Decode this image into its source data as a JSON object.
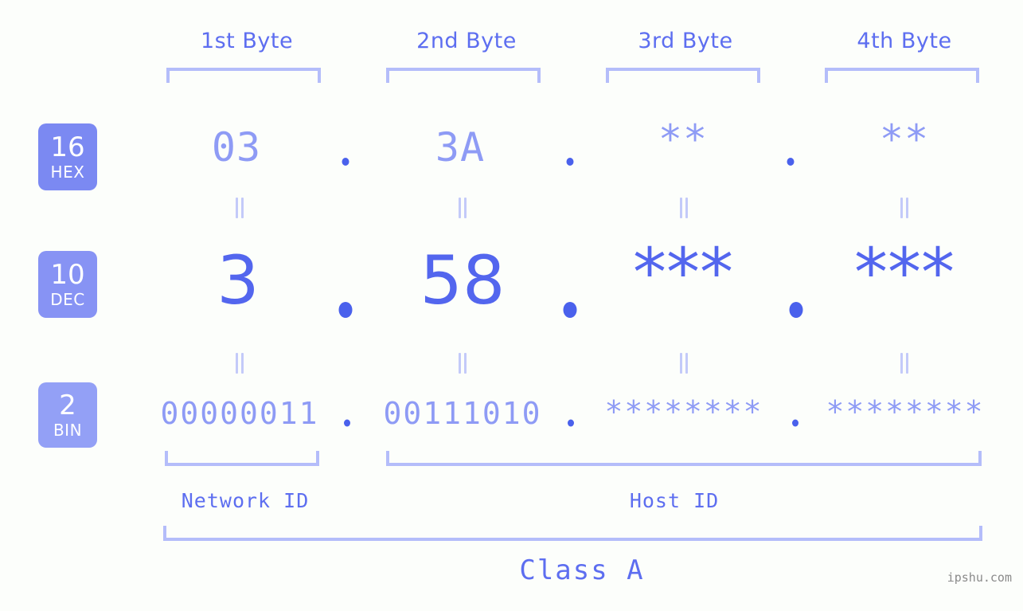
{
  "background_color": "#fcfefb",
  "accent_light": "#b4bdfa",
  "accent_mid": "#8e9bf5",
  "accent_strong": "#5366ee",
  "header": {
    "byte_labels": [
      {
        "text": "1st Byte"
      },
      {
        "text": "2nd Byte"
      },
      {
        "text": "3rd Byte"
      },
      {
        "text": "4th Byte"
      }
    ]
  },
  "radix_badges": [
    {
      "number": "16",
      "name": "HEX",
      "color": "#7b89f2"
    },
    {
      "number": "10",
      "name": "DEC",
      "color": "#8793f4"
    },
    {
      "number": "2",
      "name": "BIN",
      "color": "#93a0f6"
    }
  ],
  "rows": {
    "hex": {
      "radix": "16",
      "radix_name": "HEX",
      "values": [
        "03",
        "3A",
        "**",
        "**"
      ],
      "separator": "."
    },
    "dec": {
      "radix": "10",
      "radix_name": "DEC",
      "values": [
        "3",
        "58",
        "***",
        "***"
      ],
      "separator": "."
    },
    "bin": {
      "radix": "2",
      "radix_name": "BIN",
      "values": [
        "00000011",
        "00111010",
        "********",
        "********"
      ],
      "separator": "."
    }
  },
  "equals_marks": {
    "symbol": "=",
    "count_per_row": 4,
    "rows": 2
  },
  "footer": {
    "network_id_label": "Network ID",
    "host_id_label": "Host ID",
    "class_label": "Class A"
  },
  "watermark": {
    "text": "ipshu.com"
  }
}
